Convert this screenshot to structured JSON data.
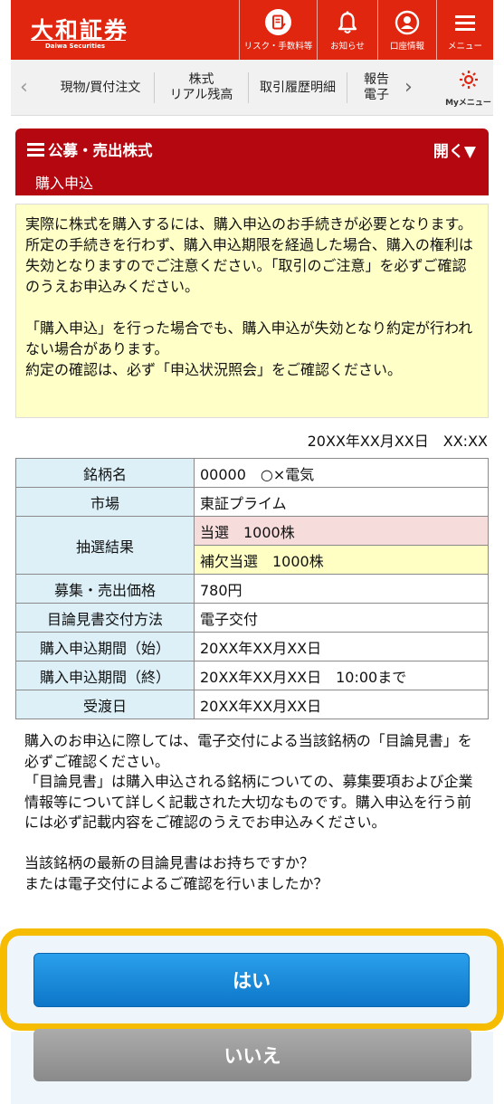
{
  "header": {
    "logo_main": "大和証券",
    "logo_sub": "Daiwa Securities",
    "buttons": [
      {
        "label": "リスク・手数料等",
        "icon": "document-pen-icon"
      },
      {
        "label": "お知らせ",
        "icon": "bell-icon"
      },
      {
        "label": "口座情報",
        "icon": "person-circle-icon"
      },
      {
        "label": "メニュー",
        "icon": "hamburger-menu-icon"
      }
    ],
    "colors": {
      "brand": "#e0260f"
    }
  },
  "nav": {
    "items": [
      "現物/買付注文",
      "株式\nリアル残高",
      "取引履歴明細",
      "報告\n電子"
    ],
    "my_menu": "Myメニュー"
  },
  "section": {
    "title": "公募・売出株式",
    "toggle": "開く▼",
    "subtitle": "購入申込",
    "color": "#b5070f"
  },
  "notice": {
    "text": "実際に株式を購入するには、購入申込のお手続きが必要となります。\n所定の手続きを行わず、購入申込期限を経過した場合、購入の権利は失効となりますのでご注意ください。「取引のご注意」を必ずご確認のうえお申込みください。\n\n「購入申込」を行った場合でも、購入申込が失効となり約定が行われない場合があります。\n約定の確認は、必ず「申込状況照会」をご確認ください。"
  },
  "datetime": "20XX年XX月XX日　XX:XX",
  "table": {
    "rows": [
      {
        "label": "銘柄名",
        "value": "00000　○×電気"
      },
      {
        "label": "市場",
        "value": "東証プライム"
      },
      {
        "label": "抽選結果",
        "value": "当選　1000株",
        "value2": "補欠当選　1000株"
      },
      {
        "label": "募集・売出価格",
        "value": "780円"
      },
      {
        "label": "目論見書交付方法",
        "value": "電子交付"
      },
      {
        "label": "購入申込期間（始）",
        "value": "20XX年XX月XX日"
      },
      {
        "label": "購入申込期間（終）",
        "value": "20XX年XX月XX日　10:00まで"
      },
      {
        "label": "受渡日",
        "value": "20XX年XX月XX日"
      }
    ]
  },
  "description": "購入のお申込に際しては、電子交付による当該銘柄の「目論見書」を必ずご確認ください。\n「目論見書」は購入申込される銘柄についての、募集要項および企業情報等について詳しく記載された大切なものです。購入申込を行う前には必ず記載内容をご確認のうえでお申込みください。\n\n当該銘柄の最新の目論見書はお持ちですか？\nまたは電子交付によるご確認を行いましたか？",
  "buttons": {
    "yes": "はい",
    "no": "いいえ"
  },
  "highlight_color": "#f6bc00"
}
